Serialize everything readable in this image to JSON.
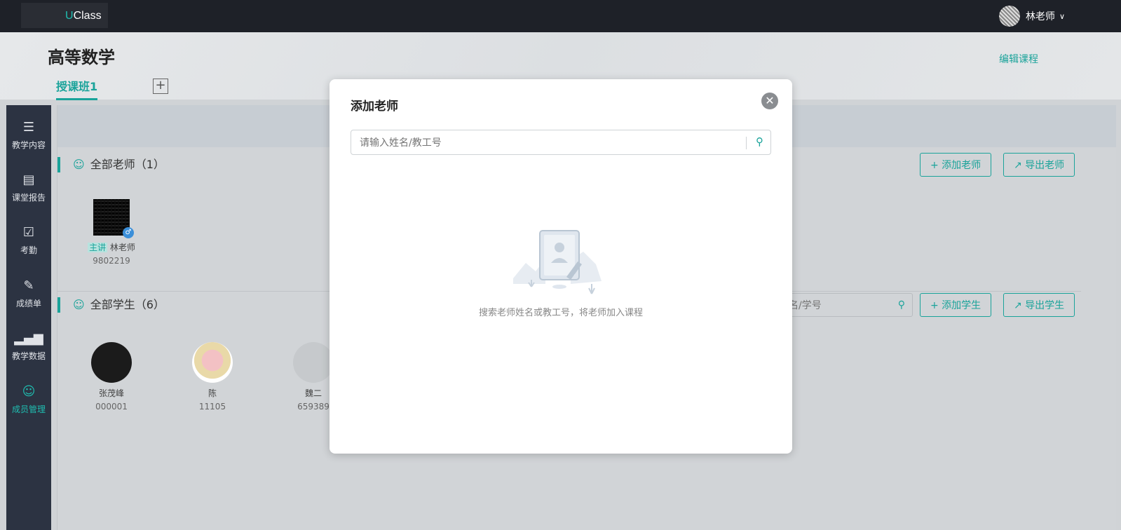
{
  "topbar": {
    "logo_prefix": "U",
    "logo_suffix": "Class",
    "user_name": "林老师"
  },
  "course": {
    "title": "高等数学",
    "edit_label": "编辑课程",
    "tab_label": "授课班1",
    "tab_add": "+"
  },
  "sidebar": {
    "items": [
      {
        "label": "教学内容",
        "icon": "layers-icon"
      },
      {
        "label": "课堂报告",
        "icon": "document-icon"
      },
      {
        "label": "考勤",
        "icon": "calendar-check-icon"
      },
      {
        "label": "成绩单",
        "icon": "grade-icon"
      },
      {
        "label": "教学数据",
        "icon": "bar-chart-icon"
      },
      {
        "label": "成员管理",
        "icon": "members-icon",
        "active": true
      }
    ]
  },
  "teachers": {
    "title": "全部老师（1）",
    "add_label": "添加老师",
    "export_label": "导出老师",
    "list": [
      {
        "role": "主讲",
        "name": "林老师",
        "number": "9802219"
      }
    ]
  },
  "students": {
    "title": "全部学生（6）",
    "search_placeholder": "姓名/学号",
    "add_label": "添加学生",
    "export_label": "导出学生",
    "list": [
      {
        "name": "张茂峰",
        "number": "000001"
      },
      {
        "name": "陈",
        "number": "11105"
      },
      {
        "name": "魏二",
        "number": "659389"
      }
    ]
  },
  "modal": {
    "title": "添加老师",
    "search_placeholder": "请输入姓名/教工号",
    "empty_text": "搜索老师姓名或教工号，将老师加入课程"
  },
  "colors": {
    "accent": "#1aa39a",
    "topbar": "#1e2128",
    "sidebar": "#2c3342"
  }
}
